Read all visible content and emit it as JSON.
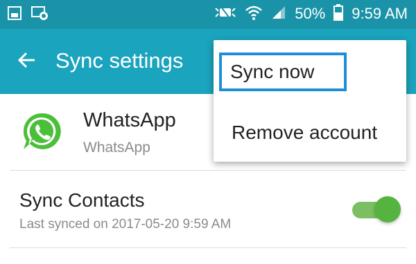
{
  "status_bar": {
    "battery": "50%",
    "time": "9:59 AM",
    "icons": [
      "gallery-icon",
      "whatsapp-notification-icon",
      "mute-icon",
      "wifi-icon",
      "signal-icon",
      "battery-icon"
    ]
  },
  "app_bar": {
    "title": "Sync settings"
  },
  "account": {
    "name": "WhatsApp",
    "type": "WhatsApp"
  },
  "sync_contacts": {
    "title": "Sync Contacts",
    "subtitle": "Last synced on 2017-05-20 9:59 AM",
    "enabled": true
  },
  "menu": {
    "items": [
      {
        "label": "Sync now",
        "selected": true
      },
      {
        "label": "Remove account",
        "selected": false
      }
    ]
  },
  "colors": {
    "status_bar": "#1a93a9",
    "app_bar": "#1ba4bd",
    "toggle_on": "#55b43f",
    "focus_outline": "#1f8ed9"
  }
}
